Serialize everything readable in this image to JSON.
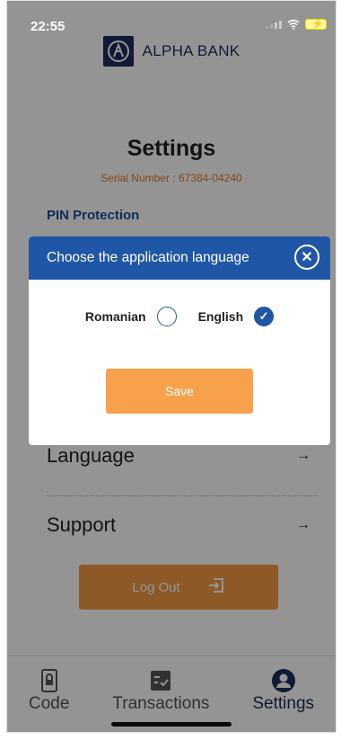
{
  "status_bar": {
    "time": "22:55"
  },
  "header": {
    "brand": "ALPHA BANK",
    "logo_icon": "alpha-bank-logo"
  },
  "page": {
    "title": "Settings",
    "serial": "Serial Number : 67384-04240",
    "pin_protection": "PIN Protection"
  },
  "rows": [
    {
      "label": "Language",
      "arrow": "→"
    },
    {
      "label": "Support",
      "arrow": "→"
    }
  ],
  "logout": {
    "label": "Log Out"
  },
  "tabs": [
    {
      "label": "Code",
      "icon": "phone-lock-icon"
    },
    {
      "label": "Transactions",
      "icon": "receipt-check-icon"
    },
    {
      "label": "Settings",
      "icon": "user-circle-icon",
      "active": true
    }
  ],
  "modal": {
    "title": "Choose the application language",
    "options": [
      {
        "label": "Romanian",
        "selected": false
      },
      {
        "label": "English",
        "selected": true
      }
    ],
    "save_label": "Save"
  },
  "colors": {
    "accent_blue": "#1f57a6",
    "accent_orange": "#f39b44",
    "brand_navy": "#1d2e5c"
  }
}
